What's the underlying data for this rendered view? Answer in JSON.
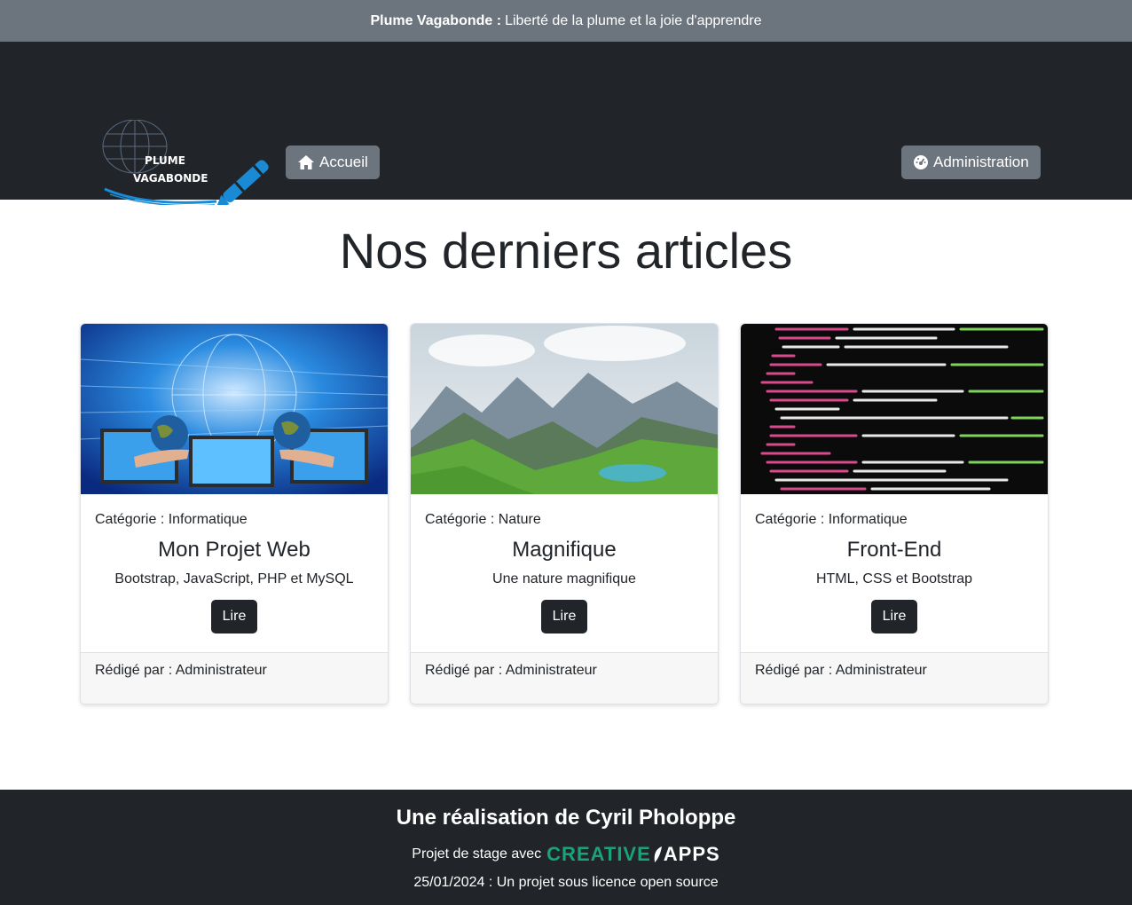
{
  "topbar": {
    "brand": "Plume Vagabonde :",
    "tagline": "Liberté de la plume et la joie d'apprendre"
  },
  "header": {
    "logo_line1": "PLUME",
    "logo_line2": "VAGABONDE",
    "home_label": "Accueil",
    "admin_label": "Administration"
  },
  "main": {
    "title": "Nos derniers articles"
  },
  "cards": [
    {
      "category": "Catégorie : Informatique",
      "title": "Mon Projet Web",
      "description": "Bootstrap, JavaScript, PHP et MySQL",
      "button": "Lire",
      "author": "Rédigé par : Administrateur",
      "image": "globe-network-image"
    },
    {
      "category": "Catégorie : Nature",
      "title": "Magnifique",
      "description": "Une nature magnifique",
      "button": "Lire",
      "author": "Rédigé par : Administrateur",
      "image": "mountain-lake-image"
    },
    {
      "category": "Catégorie : Informatique",
      "title": "Front-End",
      "description": "HTML, CSS et Bootstrap",
      "button": "Lire",
      "author": "Rédigé par : Administrateur",
      "image": "code-screen-image"
    }
  ],
  "footer": {
    "title": "Une réalisation de Cyril Pholoppe",
    "stage_text": "Projet de stage avec",
    "brand_part1": "CREATIVE",
    "brand_part2": "APPS",
    "license": "25/01/2024 : Un projet sous licence open source"
  },
  "colors": {
    "dark": "#212529",
    "gray": "#6c757d",
    "brand_blue": "#1a8ad4",
    "brand_green": "#1aa37a"
  }
}
